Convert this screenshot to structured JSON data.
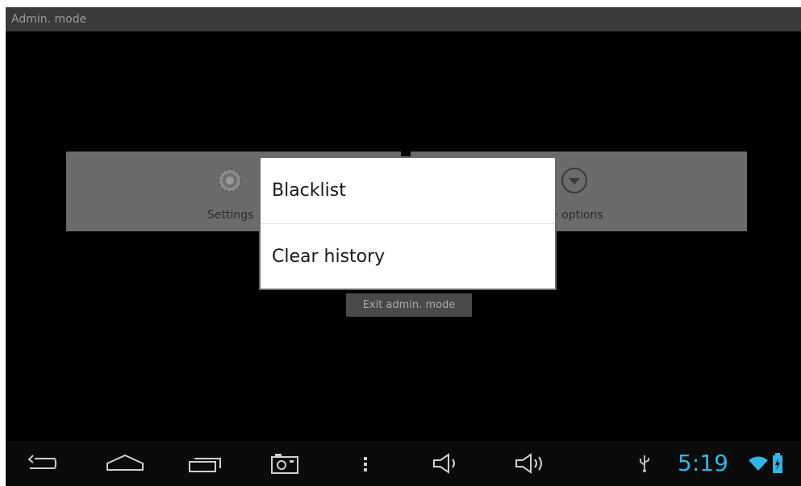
{
  "titlebar": {
    "title": "Admin. mode"
  },
  "tiles": {
    "settings_label": "Settings",
    "more_options_label": "More options"
  },
  "exit_button": {
    "label": "Exit admin. mode"
  },
  "dialog": {
    "items": [
      {
        "label": "Blacklist"
      },
      {
        "label": "Clear history"
      }
    ]
  },
  "navbar": {
    "icons": [
      "back-icon",
      "home-icon",
      "recent-apps-icon",
      "screenshot-icon",
      "menu-icon",
      "volume-down-icon",
      "volume-up-icon"
    ]
  },
  "status": {
    "time": "5:19",
    "icons": [
      "usb-icon",
      "wifi-icon",
      "battery-charging-icon"
    ],
    "accent_color": "#33b5e5"
  }
}
